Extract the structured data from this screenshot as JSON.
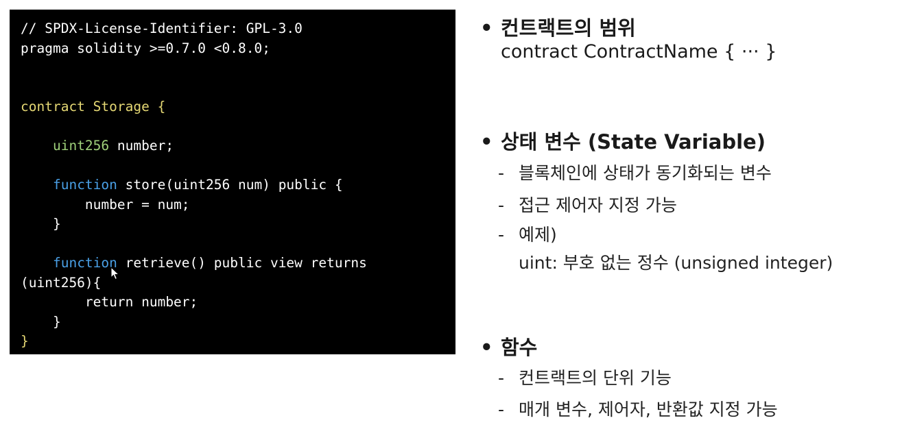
{
  "code": {
    "lines": [
      [
        {
          "t": "// SPDX-License-Identifier: GPL-3.0",
          "c": "plain"
        }
      ],
      [
        {
          "t": "pragma solidity >=0.7.0 <0.8.0;",
          "c": "plain"
        }
      ],
      [],
      [],
      [
        {
          "t": "contract Storage {",
          "c": "contract"
        }
      ],
      [],
      [
        {
          "t": "    ",
          "c": "plain"
        },
        {
          "t": "uint256",
          "c": "type"
        },
        {
          "t": " number;",
          "c": "plain"
        }
      ],
      [],
      [
        {
          "t": "    ",
          "c": "plain"
        },
        {
          "t": "function",
          "c": "func"
        },
        {
          "t": " store(uint256 num) public {",
          "c": "plain"
        }
      ],
      [
        {
          "t": "        number = num;",
          "c": "plain"
        }
      ],
      [
        {
          "t": "    }",
          "c": "plain"
        }
      ],
      [],
      [
        {
          "t": "    ",
          "c": "plain"
        },
        {
          "t": "function",
          "c": "func"
        },
        {
          "t": " retrieve() public view returns",
          "c": "plain"
        }
      ],
      [
        {
          "t": "(uint256){",
          "c": "plain"
        }
      ],
      [
        {
          "t": "        return number;",
          "c": "plain"
        }
      ],
      [
        {
          "t": "    }",
          "c": "plain"
        }
      ],
      [
        {
          "t": "}",
          "c": "contract"
        }
      ]
    ]
  },
  "notes": {
    "contract_scope": {
      "bullet": "•",
      "title": "컨트랙트의 범위",
      "body": "contract ContractName { ··· }"
    },
    "state_variable": {
      "bullet": "•",
      "title": "상태 변수 (State Variable)",
      "items": [
        {
          "dash": "-",
          "text": "블록체인에 상태가 동기화되는 변수"
        },
        {
          "dash": "-",
          "text": "접근 제어자 지정 가능"
        },
        {
          "dash": "-",
          "text": "예제)"
        }
      ],
      "example": "uint: 부호 없는 정수 (unsigned integer)"
    },
    "function": {
      "bullet": "•",
      "title": "함수",
      "items": [
        {
          "dash": "-",
          "text": "컨트랙트의 단위 기능"
        },
        {
          "dash": "-",
          "text": "매개 변수, 제어자, 반환값 지정 가능"
        }
      ]
    }
  }
}
